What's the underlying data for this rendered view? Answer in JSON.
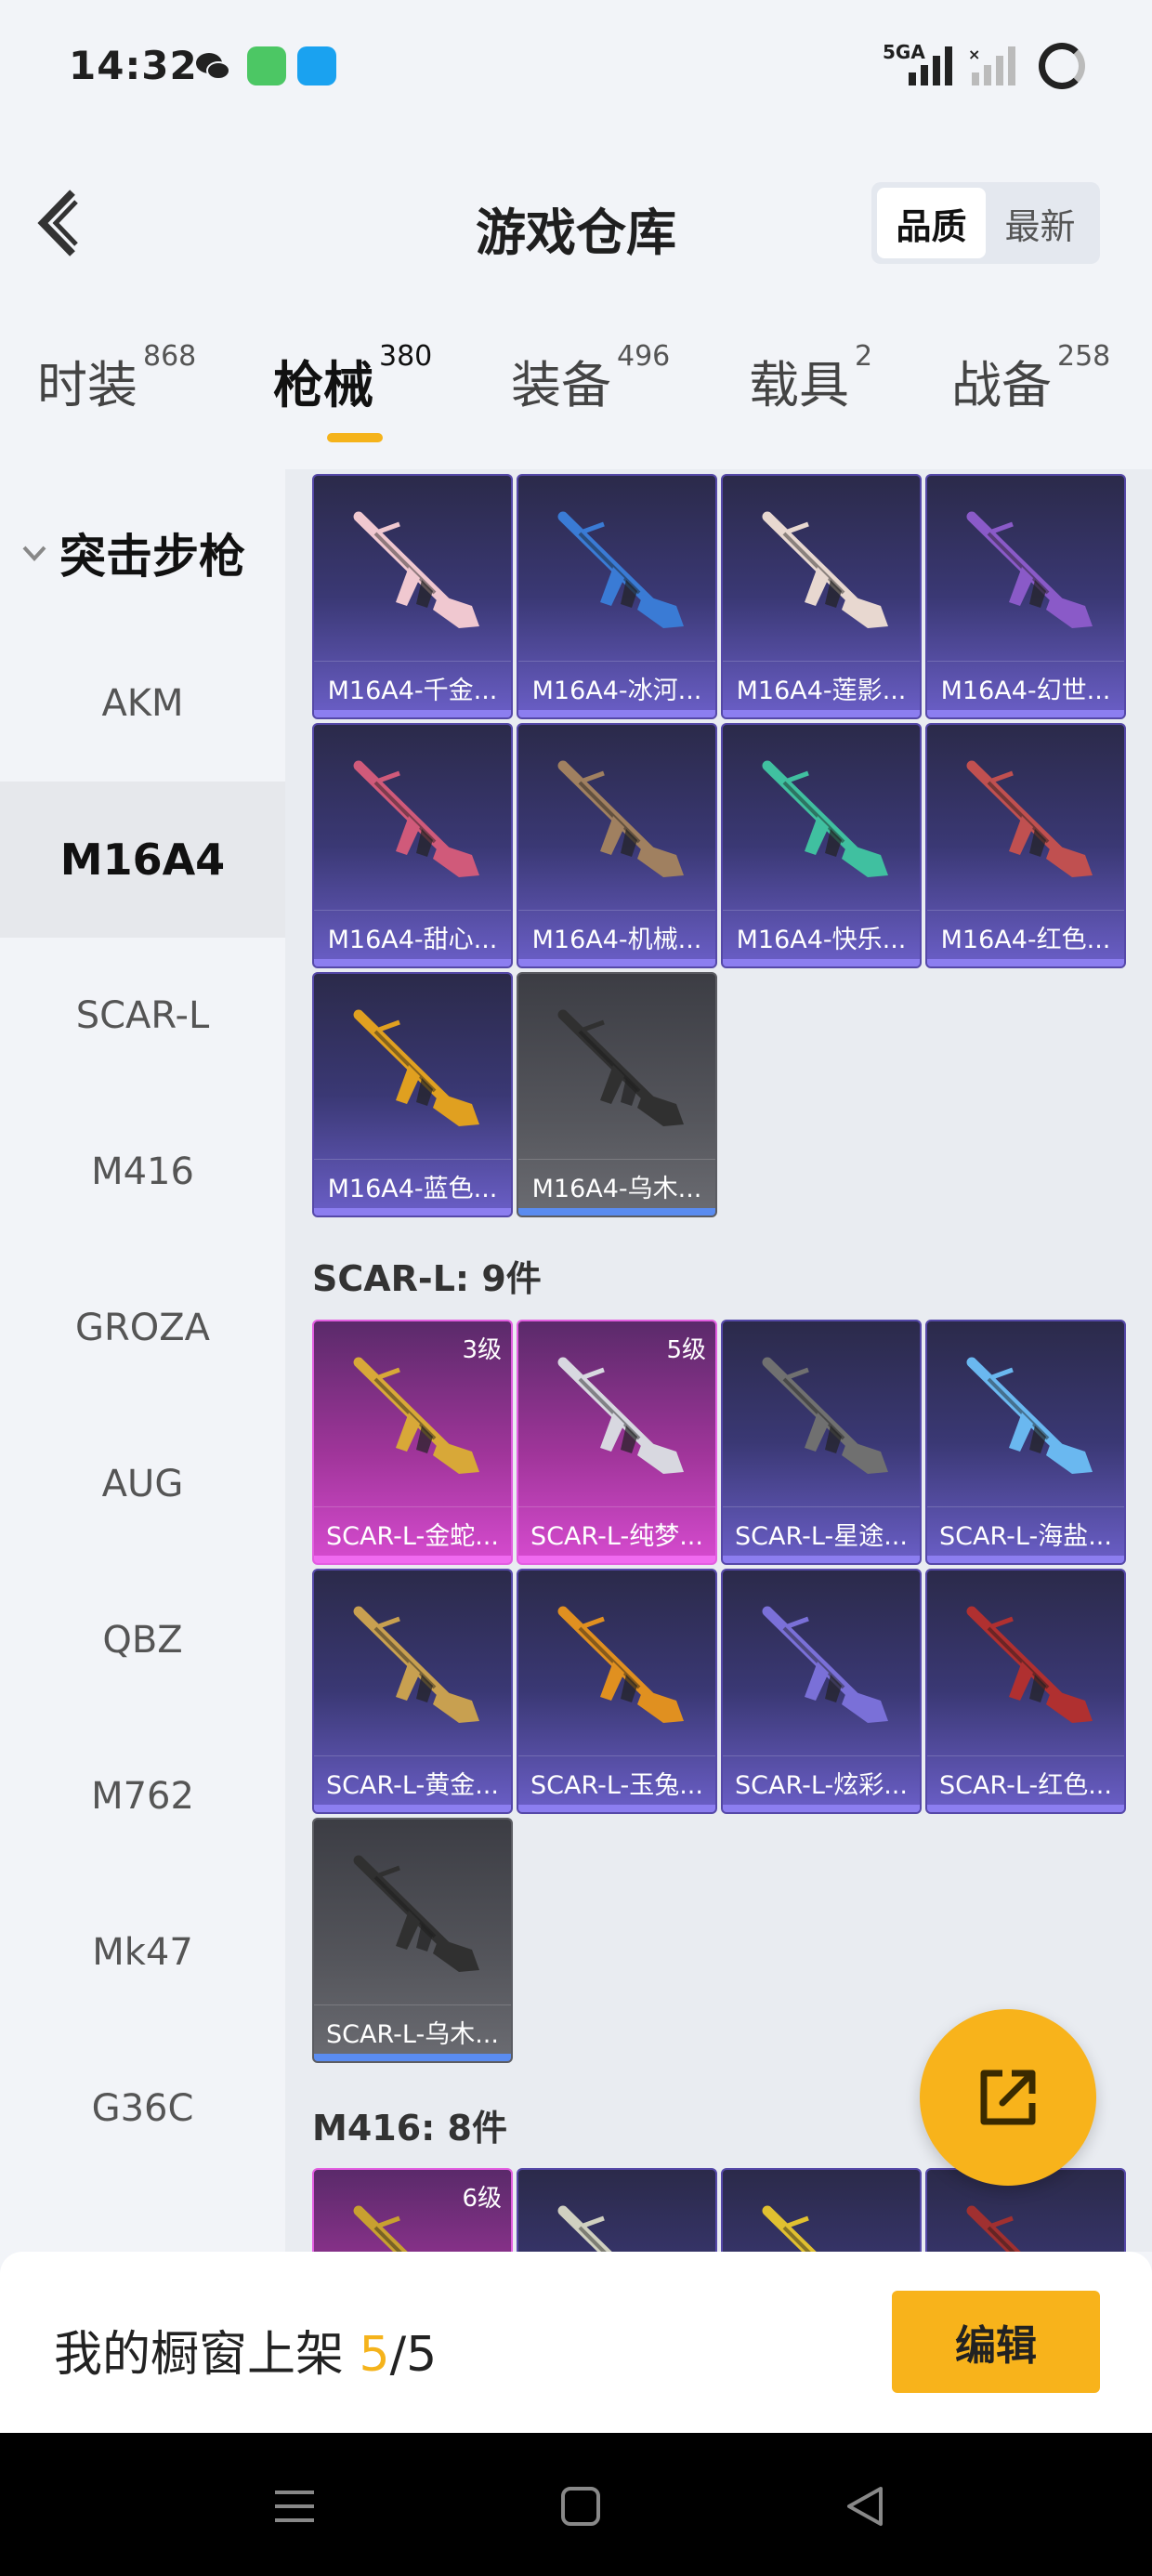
{
  "status_bar": {
    "time": "14:32",
    "network": "5GA"
  },
  "header": {
    "title": "游戏仓库",
    "sort_options": [
      "品质",
      "最新"
    ],
    "sort_active": "品质"
  },
  "tabs": [
    {
      "label": "时装",
      "count": "868"
    },
    {
      "label": "枪械",
      "count": "380"
    },
    {
      "label": "装备",
      "count": "496"
    },
    {
      "label": "载具",
      "count": "2"
    },
    {
      "label": "战备",
      "count": "258"
    }
  ],
  "active_tab": "枪械",
  "sidebar": {
    "group": "突击步枪",
    "items": [
      "AKM",
      "M16A4",
      "SCAR-L",
      "M416",
      "GROZA",
      "AUG",
      "QBZ",
      "M762",
      "Mk47",
      "G36C"
    ],
    "active_item": "M16A4"
  },
  "sections": [
    {
      "title": "",
      "items": [
        {
          "name": "M16A4-千金...",
          "rarity": "purple",
          "level": ""
        },
        {
          "name": "M16A4-冰河...",
          "rarity": "purple",
          "level": ""
        },
        {
          "name": "M16A4-莲影...",
          "rarity": "purple",
          "level": ""
        },
        {
          "name": "M16A4-幻世...",
          "rarity": "purple",
          "level": ""
        },
        {
          "name": "M16A4-甜心...",
          "rarity": "purple",
          "level": ""
        },
        {
          "name": "M16A4-机械...",
          "rarity": "purple",
          "level": ""
        },
        {
          "name": "M16A4-快乐...",
          "rarity": "purple",
          "level": ""
        },
        {
          "name": "M16A4-红色...",
          "rarity": "purple",
          "level": ""
        },
        {
          "name": "M16A4-蓝色...",
          "rarity": "purple",
          "level": ""
        },
        {
          "name": "M16A4-乌木...",
          "rarity": "gray",
          "level": ""
        }
      ]
    },
    {
      "title": "SCAR-L: 9件",
      "items": [
        {
          "name": "SCAR-L-金蛇...",
          "rarity": "magenta",
          "level": "3级"
        },
        {
          "name": "SCAR-L-纯梦...",
          "rarity": "magenta",
          "level": "5级"
        },
        {
          "name": "SCAR-L-星途...",
          "rarity": "purple",
          "level": ""
        },
        {
          "name": "SCAR-L-海盐...",
          "rarity": "purple",
          "level": ""
        },
        {
          "name": "SCAR-L-黄金...",
          "rarity": "purple",
          "level": ""
        },
        {
          "name": "SCAR-L-玉兔...",
          "rarity": "purple",
          "level": ""
        },
        {
          "name": "SCAR-L-炫彩...",
          "rarity": "purple",
          "level": ""
        },
        {
          "name": "SCAR-L-红色...",
          "rarity": "purple",
          "level": ""
        },
        {
          "name": "SCAR-L-乌木...",
          "rarity": "gray",
          "level": ""
        }
      ]
    },
    {
      "title": "M416: 8件",
      "items": [
        {
          "name": "",
          "rarity": "magenta",
          "level": "6级"
        },
        {
          "name": "",
          "rarity": "purple",
          "level": ""
        },
        {
          "name": "",
          "rarity": "purple",
          "level": ""
        },
        {
          "name": "",
          "rarity": "purple",
          "level": ""
        }
      ]
    }
  ],
  "gun_colors": [
    "#f0c8d0",
    "#3a7bd5",
    "#e8d8d0",
    "#8a5ac8",
    "#d05a7a",
    "#a08060",
    "#40c0a0",
    "#c05050",
    "#e0a020",
    "#303030",
    "#d8a838",
    "#d8d8e0",
    "#707070",
    "#6ab8f0",
    "#c8a050",
    "#e09020",
    "#7a70d8",
    "#b03030",
    "#303030",
    "#c8a030",
    "#d0d0c0",
    "#e0c030",
    "#a03030"
  ],
  "footer": {
    "label": "我的橱窗上架 ",
    "count": "5",
    "total": "/5",
    "edit": "编辑"
  },
  "colors": {
    "accent": "#f8b31b",
    "purple": "#6b5fc8",
    "magenta": "#d74bd0",
    "gray": "#55565c"
  },
  "icons": {
    "fab": "share-external-icon",
    "back": "back-chevron-icon"
  }
}
